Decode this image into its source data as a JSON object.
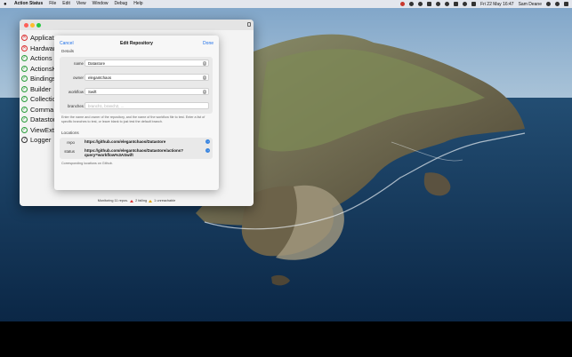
{
  "menubar": {
    "app_name": "Action Status",
    "items": [
      "File",
      "Edit",
      "View",
      "Window",
      "Debug",
      "Help"
    ],
    "clock": "Fri 22 May  16:47",
    "user": "Sam Deane"
  },
  "window": {
    "repos": [
      {
        "label": "Applicat",
        "status": "fail"
      },
      {
        "label": "Hardwar",
        "status": "fail"
      },
      {
        "label": "Actions",
        "status": "pass"
      },
      {
        "label": "ActionsK",
        "status": "pass"
      },
      {
        "label": "Bindings",
        "status": "pass"
      },
      {
        "label": "Builder",
        "status": "pass"
      },
      {
        "label": "Collectio",
        "status": "pass"
      },
      {
        "label": "Comma",
        "status": "pass"
      },
      {
        "label": "Datastor",
        "status": "pass"
      },
      {
        "label": "ViewExte",
        "status": "pass"
      },
      {
        "label": "Logger",
        "status": "unknown"
      }
    ],
    "statusbar": {
      "monitoring": "Monitoring 11 repos.",
      "failing": "2 failing",
      "unreachable": "1 unreachable"
    }
  },
  "sheet": {
    "title": "Edit Repository",
    "cancel_label": "Cancel",
    "done_label": "Done",
    "details_header": "Details",
    "fields": {
      "name": {
        "label": "name",
        "value": "Datastore"
      },
      "owner": {
        "label": "owner",
        "value": "elegantchaos"
      },
      "workflow": {
        "label": "workflow",
        "value": "Swift"
      },
      "branches": {
        "label": "branches",
        "value": "",
        "placeholder": "branch1, branch2, ..."
      }
    },
    "details_help": "Enter the name and owner of the repository, and the name of the workflow file to test. Enter a list of specific branches to test, or leave blank to just test the default branch.",
    "locations_header": "Locations",
    "repo_label": "repo",
    "repo_url": "https://github.com/elegantchaos/Datastore",
    "status_label": "status",
    "status_url": "https://github.com/elegantchaos/Datastore/actions?query=workflow%3ASwift",
    "locations_help": "Corresponding locations on Github."
  },
  "colors": {
    "accent": "#1d6fe8",
    "fail": "#dd3333",
    "pass": "#2a9d3a",
    "warning": "#e0a400"
  }
}
